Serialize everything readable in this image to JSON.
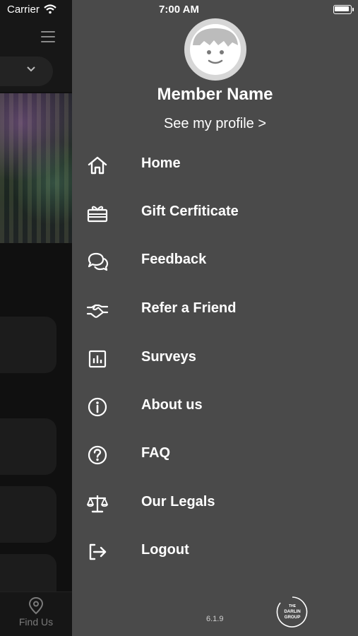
{
  "status_bar": {
    "carrier": "Carrier",
    "time": "7:00 AM"
  },
  "background": {
    "tab_find_us": "Find Us"
  },
  "drawer": {
    "member_name": "Member Name",
    "profile_link": "See my profile >",
    "menu": [
      {
        "label": "Home",
        "icon": "home-icon"
      },
      {
        "label": "Gift Cerfiticate",
        "icon": "gift-icon"
      },
      {
        "label": "Feedback",
        "icon": "chat-bubbles-icon"
      },
      {
        "label": "Refer a Friend",
        "icon": "handshake-icon"
      },
      {
        "label": "Surveys",
        "icon": "bar-chart-icon"
      },
      {
        "label": "About us",
        "icon": "info-icon"
      },
      {
        "label": "FAQ",
        "icon": "question-icon"
      },
      {
        "label": "Our Legals",
        "icon": "scales-icon"
      },
      {
        "label": "Logout",
        "icon": "logout-icon"
      }
    ],
    "version": "6.1.9",
    "logo_text": "THE DARLIN GROUP"
  },
  "colors": {
    "drawer_bg": "#4a4a4a",
    "text": "#ffffff",
    "background_app": "#101010"
  }
}
